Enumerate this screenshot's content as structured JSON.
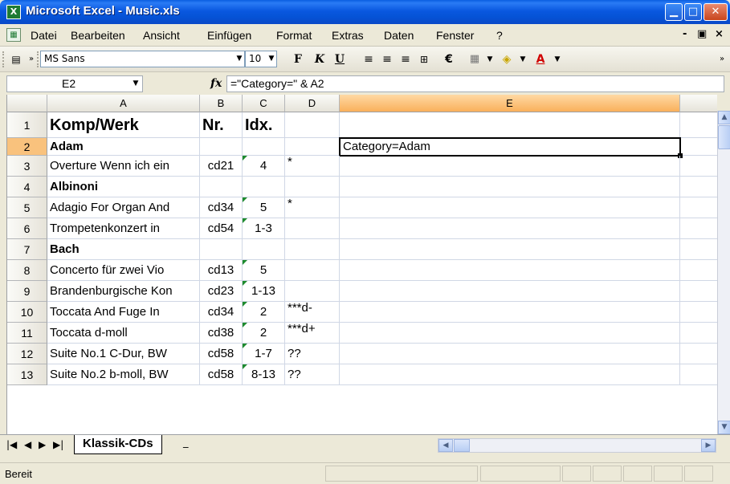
{
  "window": {
    "title": "Microsoft Excel - Music.xls",
    "app_icon": "excel-icon",
    "controls": {
      "minimize": "_",
      "maximize": "□",
      "close": "X"
    }
  },
  "menu": {
    "items": [
      "Datei",
      "Bearbeiten",
      "Ansicht",
      "Einfügen",
      "Format",
      "Extras",
      "Daten",
      "Fenster",
      "?"
    ],
    "right_controls": [
      "_",
      "♬",
      "×"
    ]
  },
  "toolbar": {
    "font_name": "MS Sans",
    "font_size": "10",
    "bold": "F",
    "italic": "K",
    "underline": "U",
    "currency": "€",
    "icons": [
      "align-left-icon",
      "align-center-icon",
      "align-right-icon",
      "merge-center-icon",
      "borders-icon",
      "fill-color-icon",
      "font-color-icon"
    ]
  },
  "formula_bar": {
    "name_box": "E2",
    "fx": "fx",
    "formula": "=\"Category=\" & A2"
  },
  "grid": {
    "columns": [
      "A",
      "B",
      "C",
      "D",
      "E"
    ],
    "active_column": "E",
    "active_row": "2",
    "rows": [
      {
        "num": "1",
        "a": "Komp/Werk",
        "b": "Nr.",
        "c": "Idx.",
        "d": "",
        "e": ""
      },
      {
        "num": "2",
        "a": "Adam",
        "b": "",
        "c": "",
        "d": "",
        "e": "Category=Adam"
      },
      {
        "num": "3",
        "a": "Overture Wenn ich ein",
        "b": "cd21",
        "c": "4",
        "d": "*",
        "e": ""
      },
      {
        "num": "4",
        "a": "Albinoni",
        "b": "",
        "c": "",
        "d": "",
        "e": ""
      },
      {
        "num": "5",
        "a": "Adagio For Organ And",
        "b": "cd34",
        "c": "5",
        "d": "*",
        "e": ""
      },
      {
        "num": "6",
        "a": "Trompetenkonzert in",
        "b": "cd54",
        "c": "1-3",
        "d": "",
        "e": ""
      },
      {
        "num": "7",
        "a": "Bach",
        "b": "",
        "c": "",
        "d": "",
        "e": ""
      },
      {
        "num": "8",
        "a": "Concerto für zwei Vio",
        "b": "cd13",
        "c": "5",
        "d": "",
        "e": ""
      },
      {
        "num": "9",
        "a": "Brandenburgische Kon",
        "b": "cd23",
        "c": "1-13",
        "d": "",
        "e": ""
      },
      {
        "num": "10",
        "a": "Toccata And Fuge In",
        "b": "cd34",
        "c": "2",
        "d": "***d-",
        "e": ""
      },
      {
        "num": "11",
        "a": "Toccata d-moll",
        "b": "cd38",
        "c": "2",
        "d": "***d+",
        "e": ""
      },
      {
        "num": "12",
        "a": "Suite No.1 C-Dur, BW",
        "b": "cd58",
        "c": "1-7",
        "d": "??",
        "e": ""
      },
      {
        "num": "13",
        "a": "Suite No.2 b-moll, BW",
        "b": "cd58",
        "c": "8-13",
        "d": "??",
        "e": ""
      }
    ]
  },
  "sheets": {
    "active": "Klassik-CDs",
    "other": "_"
  },
  "status": {
    "text": "Bereit"
  }
}
